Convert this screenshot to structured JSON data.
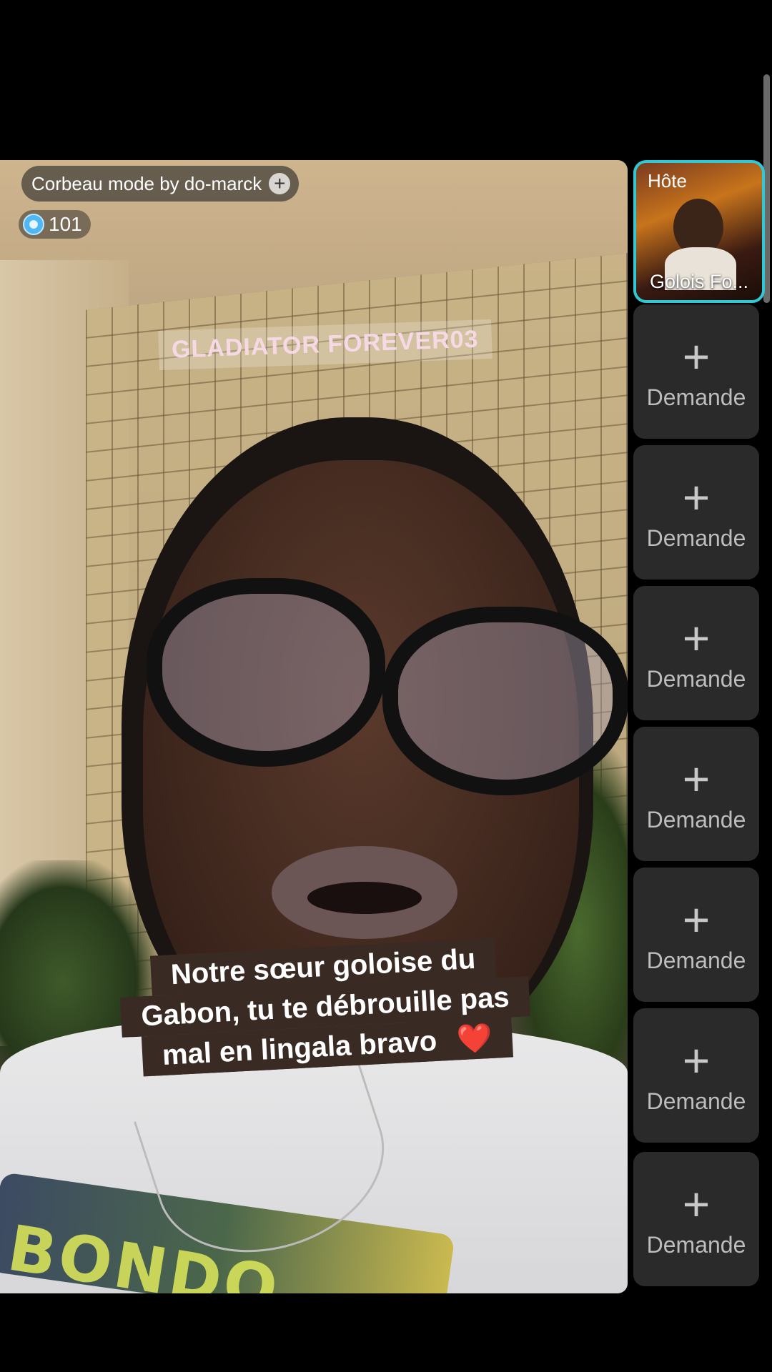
{
  "room": {
    "title": "Corbeau mode by do-marck",
    "viewer_count": "101",
    "gem_icon": "diamond-icon"
  },
  "video": {
    "watermark": "GLADIATOR FOREVER03",
    "caption": "Notre sœur goloise du Gabon, tu te débrouille pas mal en lingala bravo",
    "caption_emoji": "❤️",
    "shirt_text": "BONDO"
  },
  "host": {
    "label": "Hôte",
    "name": "Golois Fo..."
  },
  "slots": [
    {
      "label": "Demande"
    },
    {
      "label": "Demande"
    },
    {
      "label": "Demande"
    },
    {
      "label": "Demande"
    },
    {
      "label": "Demande"
    },
    {
      "label": "Demande"
    },
    {
      "label": "Demande"
    }
  ],
  "colors": {
    "host_border": "#2fc9d6",
    "slot_bg": "#2a2a2a",
    "caption_bg": "#3a2a24"
  }
}
